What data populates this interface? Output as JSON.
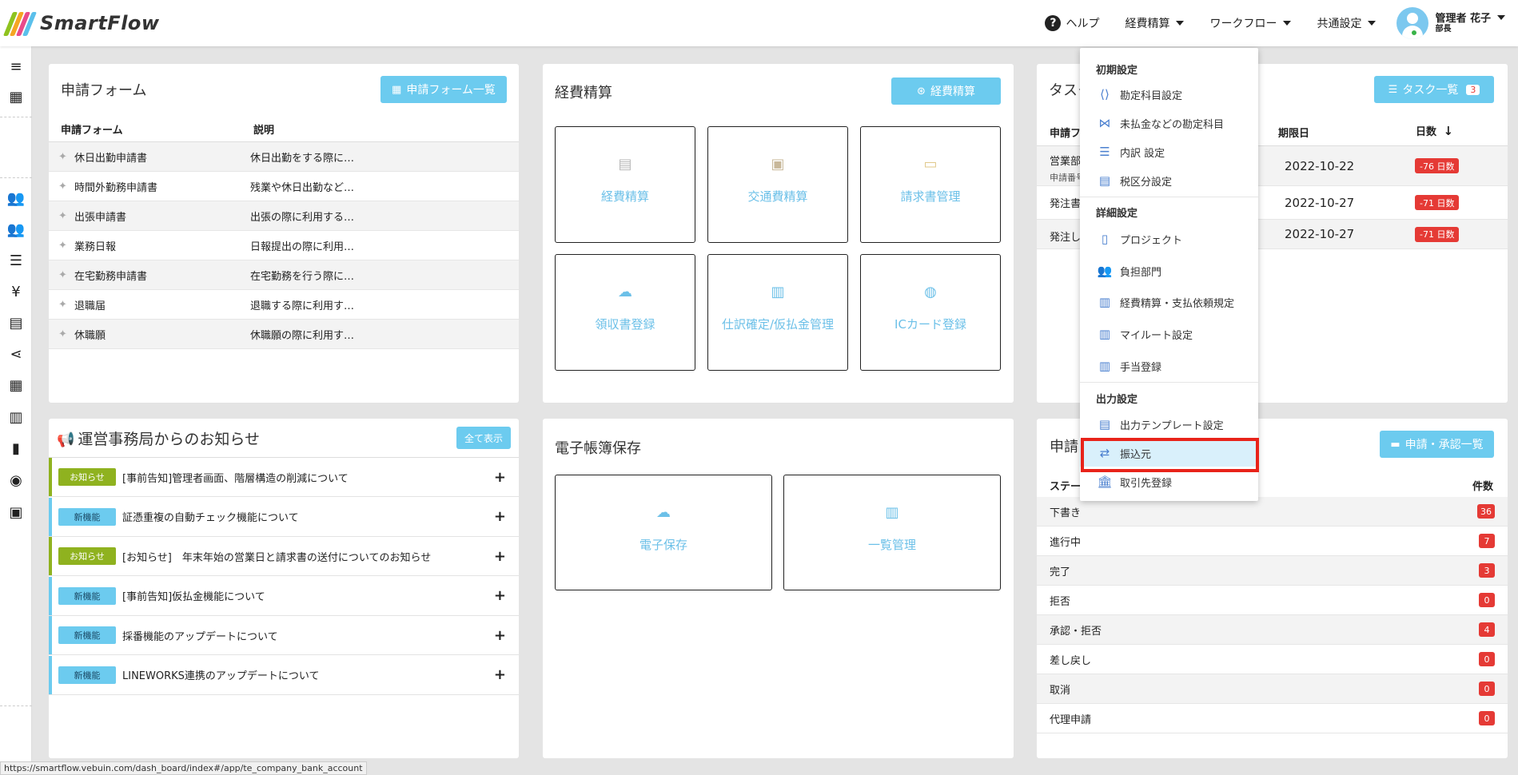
{
  "app": {
    "name": "SmartFlow"
  },
  "topnav": {
    "help": "ヘルプ",
    "expense": "経費精算",
    "workflow": "ワークフロー",
    "common": "共通設定",
    "user_name": "管理者 花子",
    "user_role": "部長"
  },
  "forms_panel": {
    "title": "申請フォーム",
    "button": "申請フォーム一覧",
    "col_form": "申請フォーム",
    "col_desc": "説明",
    "rows": [
      {
        "name": "休日出勤申請書",
        "desc": "休日出勤をする際に…"
      },
      {
        "name": "時間外勤務申請書",
        "desc": "残業や休日出勤など…"
      },
      {
        "name": "出張申請書",
        "desc": "出張の際に利用する…"
      },
      {
        "name": "業務日報",
        "desc": "日報提出の際に利用…"
      },
      {
        "name": "在宅勤務申請書",
        "desc": "在宅勤務を行う際に…"
      },
      {
        "name": "退職届",
        "desc": "退職する際に利用す…"
      },
      {
        "name": "休職願",
        "desc": "休職願の際に利用す…"
      }
    ]
  },
  "expense_panel": {
    "title": "経費精算",
    "button": "経費精算",
    "tiles": [
      "経費精算",
      "交通費精算",
      "請求書管理",
      "領収書登録",
      "仕訳確定/仮払金管理",
      "ICカード登録"
    ]
  },
  "task_panel": {
    "title": "タスク",
    "button": "タスク一覧",
    "button_count": "3",
    "col_form": "申請フ",
    "col_due": "期限日",
    "col_days": "日数",
    "rows": [
      {
        "name": "営業部",
        "sub": "申請番号",
        "due": "2022-10-22",
        "days": "-76 日数"
      },
      {
        "name": "発注書",
        "sub": "",
        "due": "2022-10-27",
        "days": "-71 日数"
      },
      {
        "name": "発注し",
        "sub": "",
        "due": "2022-10-27",
        "days": "-71 日数"
      }
    ]
  },
  "notice_panel": {
    "title": "運営事務局からのお知らせ",
    "button": "全て表示",
    "items": [
      {
        "tag": "お知らせ",
        "text": "[事前告知]管理者画面、階層構造の削減について"
      },
      {
        "tag": "新機能",
        "text": "証憑重複の自動チェック機能について"
      },
      {
        "tag": "お知らせ",
        "text": "[お知らせ]　年末年始の営業日と請求書の送付についてのお知らせ"
      },
      {
        "tag": "新機能",
        "text": "[事前告知]仮払金機能について"
      },
      {
        "tag": "新機能",
        "text": "採番機能のアップデートについて"
      },
      {
        "tag": "新機能",
        "text": "LINEWORKS連携のアップデートについて"
      }
    ]
  },
  "ebook_panel": {
    "title": "電子帳簿保存",
    "tiles": [
      "電子保存",
      "一覧管理"
    ]
  },
  "approval_panel": {
    "title": "申請",
    "button": "申請・承認一覧",
    "col_status": "ステー",
    "col_count": "件数",
    "rows": [
      {
        "label": "下書き",
        "count": "36"
      },
      {
        "label": "進行中",
        "count": "7"
      },
      {
        "label": "完了",
        "count": "3"
      },
      {
        "label": "拒否",
        "count": "0"
      },
      {
        "label": "承認・拒否",
        "count": "4"
      },
      {
        "label": "差し戻し",
        "count": "0"
      },
      {
        "label": "取消",
        "count": "0"
      },
      {
        "label": "代理申請",
        "count": "0"
      }
    ]
  },
  "dropdown": {
    "sec1": "初期設定",
    "sec1_items": [
      "勘定科目設定",
      "未払金などの勘定科目",
      "内訳 設定",
      "税区分設定"
    ],
    "sec2": "詳細設定",
    "sec2_items": [
      "プロジェクト",
      "負担部門",
      "経費精算・支払依頼規定",
      "マイルート設定",
      "手当登録"
    ],
    "sec3": "出力設定",
    "sec3_items": [
      "出力テンプレート設定",
      "振込元",
      "取引先登録"
    ]
  },
  "status_url": "https://smartflow.vebuin.com/dash_board/index#/app/te_company_bank_account",
  "colors": {
    "accent": "#6ccbef",
    "danger": "#e53a35",
    "notice_green": "#8fb21f",
    "highlight": "#e8231a"
  }
}
